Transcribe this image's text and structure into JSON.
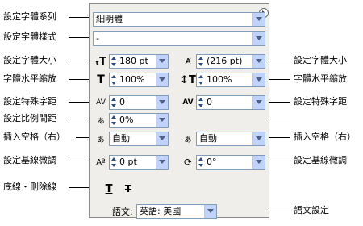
{
  "labels_left": [
    {
      "key": "font_family",
      "text": "設定字體系列"
    },
    {
      "key": "font_style",
      "text": "設定字體樣式"
    },
    {
      "key": "font_size",
      "text": "設定字體大小"
    },
    {
      "key": "h_scale",
      "text": "字體水平縮放"
    },
    {
      "key": "kerning",
      "text": "設定特殊字距"
    },
    {
      "key": "proportional",
      "text": "設定比例間距"
    },
    {
      "key": "aki_left",
      "text": "插入空格（右）"
    },
    {
      "key": "baseline",
      "text": "設定基線微調"
    },
    {
      "key": "underline",
      "text": "底線・刪除線"
    }
  ],
  "labels_right": {
    "leading": "設定字體大小",
    "v_scale": "字體水平縮放",
    "tracking": "設定特殊字距",
    "aki_right": "插入空格（右）",
    "rotate": "設定基線微調",
    "language": "語文設定"
  },
  "panel": {
    "font_family": "細明體",
    "font_style": "-",
    "font_size": "180 pt",
    "leading": "(216 pt)",
    "h_scale": "100%",
    "v_scale": "100%",
    "kerning": "0",
    "tracking": "0",
    "proportional": "0%",
    "aki_left": "自動",
    "aki_right": "自動",
    "baseline": "0 pt",
    "rotate": "0°",
    "language_label": "語文:",
    "language_value": "英語: 美國"
  },
  "icons": {
    "font_size": "font-size-icon",
    "leading": "leading-icon",
    "h_scale": "horizontal-scale-icon",
    "v_scale": "vertical-scale-icon",
    "kerning": "kerning-icon",
    "tracking": "tracking-icon",
    "proportional": "tsume-icon",
    "aki_left": "aki-left-icon",
    "aki_right": "aki-right-icon",
    "baseline": "baseline-shift-icon",
    "rotate": "character-rotation-icon",
    "underline": "underline-icon",
    "strikethrough": "strikethrough-icon"
  }
}
